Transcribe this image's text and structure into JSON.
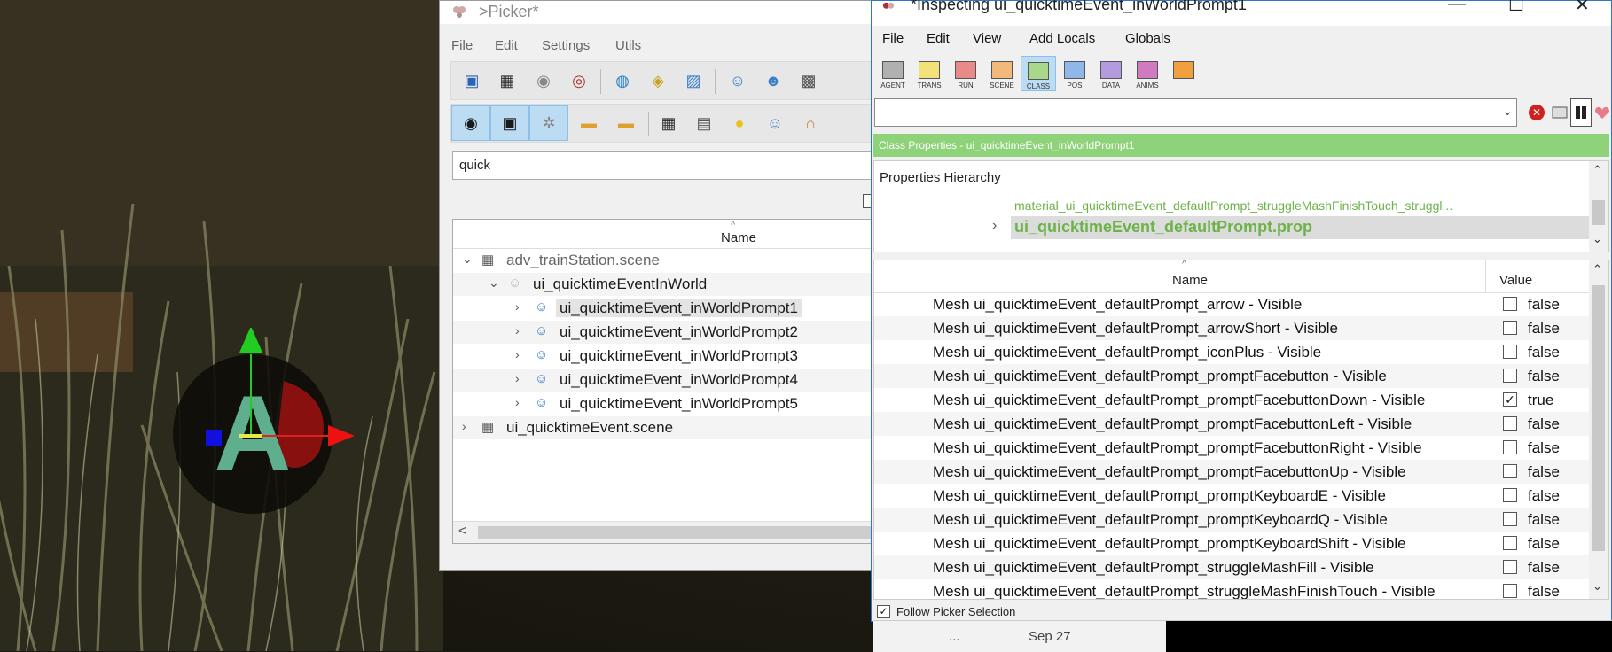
{
  "picker": {
    "title": ">Picker*",
    "menu": [
      "File",
      "Edit",
      "Settings",
      "Utils"
    ],
    "search_value": "quick",
    "tree_header": "Name",
    "tree": [
      {
        "label": "adv_trainStation.scene",
        "level": 0,
        "arrow": "⌄",
        "icon": "scene"
      },
      {
        "label": "ui_quicktimeEventInWorld",
        "level": 1,
        "arrow": "⌄",
        "icon": "agent-dim"
      },
      {
        "label": "ui_quicktimeEvent_inWorldPrompt1",
        "level": 2,
        "arrow": "›",
        "icon": "agent",
        "selected": true
      },
      {
        "label": "ui_quicktimeEvent_inWorldPrompt2",
        "level": 2,
        "arrow": "›",
        "icon": "agent"
      },
      {
        "label": "ui_quicktimeEvent_inWorldPrompt3",
        "level": 2,
        "arrow": "›",
        "icon": "agent"
      },
      {
        "label": "ui_quicktimeEvent_inWorldPrompt4",
        "level": 2,
        "arrow": "›",
        "icon": "agent"
      },
      {
        "label": "ui_quicktimeEvent_inWorldPrompt5",
        "level": 2,
        "arrow": "›",
        "icon": "agent"
      },
      {
        "label": "ui_quicktimeEvent.scene",
        "level": 0,
        "arrow": "›",
        "icon": "scene"
      }
    ]
  },
  "inspector": {
    "title": "*Inspecting ui_quicktimeEvent_inWorldPrompt1",
    "menu": [
      "File",
      "Edit",
      "View",
      "Add Locals",
      "Globals"
    ],
    "toolbar": [
      {
        "label": "AGENT",
        "color": "#b0b0b0"
      },
      {
        "label": "TRANS",
        "color": "#f3e27a"
      },
      {
        "label": "RUN",
        "color": "#e88a8a"
      },
      {
        "label": "SCENE",
        "color": "#f2b97a"
      },
      {
        "label": "CLASS",
        "color": "#a8d88a",
        "selected": true
      },
      {
        "label": "POS",
        "color": "#8fb8e8"
      },
      {
        "label": "DATA",
        "color": "#b49be0"
      },
      {
        "label": "ANIMS",
        "color": "#d07ac0"
      },
      {
        "label": "",
        "color": "#f0a040"
      }
    ],
    "class_bar": "Class Properties - ui_quicktimeEvent_inWorldPrompt1",
    "hierarchy_label": "Properties Hierarchy",
    "hierarchy_material": "material_ui_quicktimeEvent_defaultPrompt_struggleMashFinishTouch_struggl...",
    "hierarchy_selected": "ui_quicktimeEvent_defaultPrompt.prop",
    "col_name": "Name",
    "col_value": "Value",
    "properties": [
      {
        "name": "Mesh ui_quicktimeEvent_defaultPrompt_arrow - Visible",
        "checked": false,
        "value": "false"
      },
      {
        "name": "Mesh ui_quicktimeEvent_defaultPrompt_arrowShort - Visible",
        "checked": false,
        "value": "false"
      },
      {
        "name": "Mesh ui_quicktimeEvent_defaultPrompt_iconPlus - Visible",
        "checked": false,
        "value": "false"
      },
      {
        "name": "Mesh ui_quicktimeEvent_defaultPrompt_promptFacebutton - Visible",
        "checked": false,
        "value": "false"
      },
      {
        "name": "Mesh ui_quicktimeEvent_defaultPrompt_promptFacebuttonDown - Visible",
        "checked": true,
        "value": "true"
      },
      {
        "name": "Mesh ui_quicktimeEvent_defaultPrompt_promptFacebuttonLeft - Visible",
        "checked": false,
        "value": "false"
      },
      {
        "name": "Mesh ui_quicktimeEvent_defaultPrompt_promptFacebuttonRight - Visible",
        "checked": false,
        "value": "false"
      },
      {
        "name": "Mesh ui_quicktimeEvent_defaultPrompt_promptFacebuttonUp - Visible",
        "checked": false,
        "value": "false"
      },
      {
        "name": "Mesh ui_quicktimeEvent_defaultPrompt_promptKeyboardE - Visible",
        "checked": false,
        "value": "false"
      },
      {
        "name": "Mesh ui_quicktimeEvent_defaultPrompt_promptKeyboardQ - Visible",
        "checked": false,
        "value": "false"
      },
      {
        "name": "Mesh ui_quicktimeEvent_defaultPrompt_promptKeyboardShift - Visible",
        "checked": false,
        "value": "false"
      },
      {
        "name": "Mesh ui_quicktimeEvent_defaultPrompt_struggleMashFill - Visible",
        "checked": false,
        "value": "false"
      },
      {
        "name": "Mesh ui_quicktimeEvent_defaultPrompt_struggleMashFinishTouch - Visible",
        "checked": false,
        "value": "false"
      }
    ],
    "follow_label": "Follow Picker Selection",
    "follow_checked": true
  },
  "game": {
    "prompt_letter": "A"
  },
  "taskbar": {
    "ellipsis": "...",
    "date": "Sep 27"
  }
}
